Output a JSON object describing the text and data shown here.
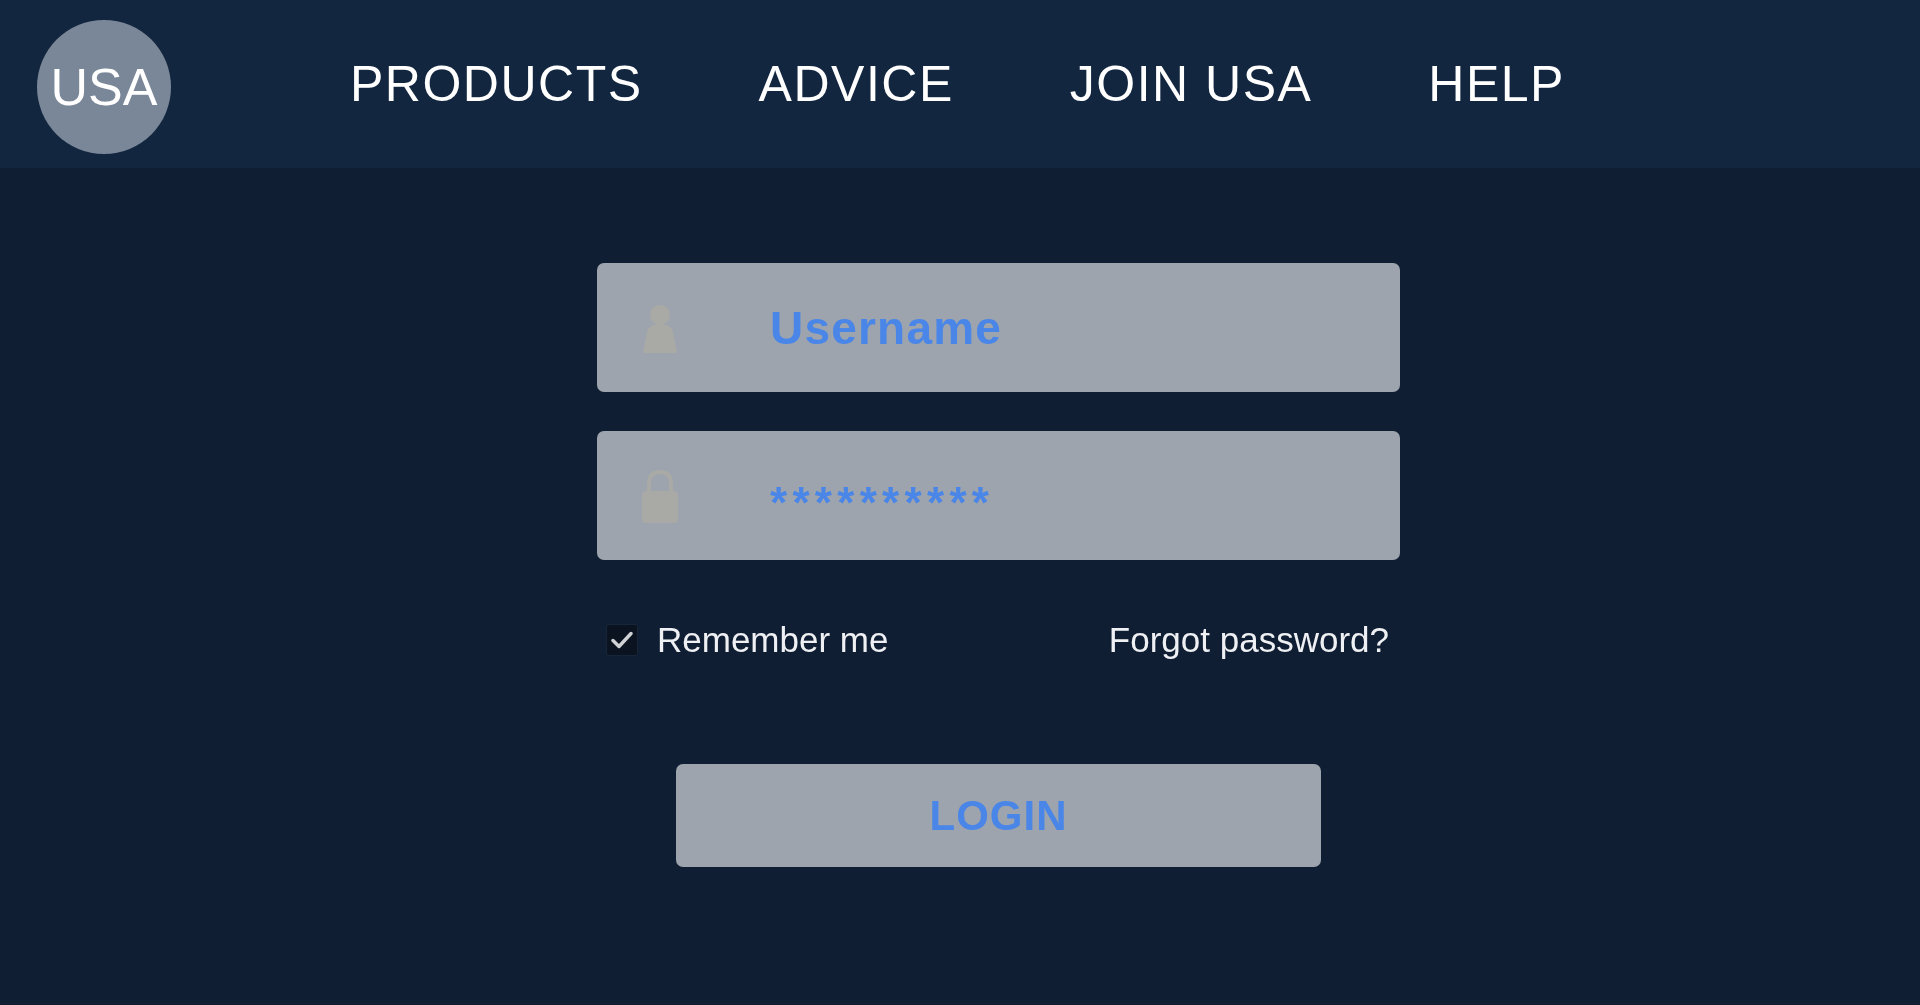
{
  "header": {
    "logo": "USA",
    "nav": [
      "PRODUCTS",
      "ADVICE",
      "JOIN USA",
      "HELP"
    ]
  },
  "login_form": {
    "username": {
      "placeholder": "Username"
    },
    "password": {
      "value": "**********"
    },
    "remember_me": {
      "label": "Remember me",
      "checked": true
    },
    "forgot_password": "Forgot password?",
    "login_button": "LOGIN"
  }
}
